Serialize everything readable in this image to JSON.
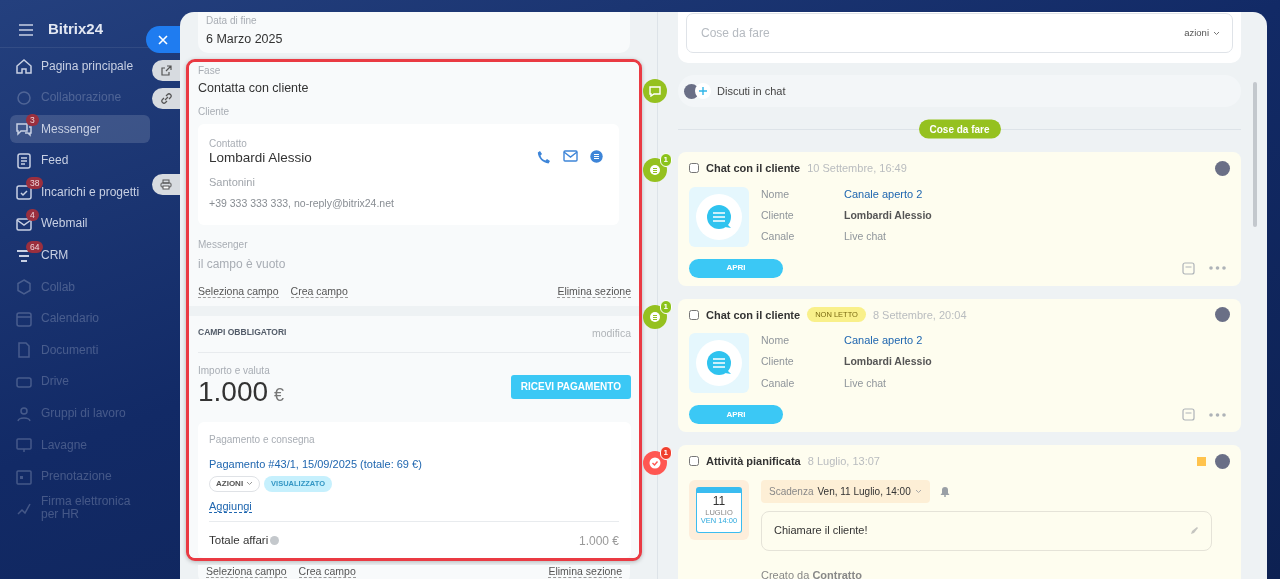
{
  "sidebar": {
    "logo": "Bitrix24",
    "items": [
      {
        "label": "Pagina principale",
        "selected": false,
        "dimmed": false
      },
      {
        "label": "Collaborazione",
        "selected": false,
        "dimmed": true
      },
      {
        "label": "Messenger",
        "badge": "3",
        "selected": true,
        "dimmed": false
      },
      {
        "label": "Feed",
        "selected": false,
        "dimmed": false
      },
      {
        "label": "Incarichi e progetti",
        "badge": "38",
        "selected": false,
        "dimmed": false
      },
      {
        "label": "Webmail",
        "badge": "4",
        "selected": false,
        "dimmed": false
      },
      {
        "label": "CRM",
        "badge": "64",
        "selected": false,
        "dimmed": false
      },
      {
        "label": "Collab",
        "selected": false,
        "dimmed": true
      },
      {
        "label": "Calendario",
        "selected": false,
        "dimmed": true
      },
      {
        "label": "Documenti",
        "selected": false,
        "dimmed": true
      },
      {
        "label": "Drive",
        "selected": false,
        "dimmed": true
      },
      {
        "label": "Gruppi di lavoro",
        "selected": false,
        "dimmed": true
      },
      {
        "label": "Lavagne",
        "selected": false,
        "dimmed": true
      },
      {
        "label": "Prenotazione",
        "selected": false,
        "dimmed": true
      },
      {
        "label": "Firma elettronica per HR",
        "selected": false,
        "dimmed": true
      }
    ]
  },
  "details": {
    "end_date": {
      "label": "Data di fine",
      "value": "6 Marzo 2025"
    },
    "stage": {
      "label": "Fase",
      "value": "Contatta con cliente"
    },
    "client": {
      "label": "Cliente",
      "type_label": "Contatto",
      "name": "Lombardi Alessio",
      "company": "Santonini",
      "contacts": "+39 333 333 333, no-reply@bitrix24.net"
    },
    "messenger": {
      "label": "Messenger",
      "value": "il campo è vuoto"
    },
    "section_links": [
      "Seleziona campo",
      "Crea campo",
      "Elimina sezione"
    ],
    "required": {
      "title": "CAMPI OBBLIGATORI",
      "edit": "modifica",
      "amount_label": "Importo e valuta",
      "amount": "1.000",
      "currency": "€",
      "pay_button": "RICEVI PAGAMENTO",
      "payment": {
        "label": "Pagamento e consegna",
        "link": "Pagamento #43/1, 15/09/2025 (totale: 69 €)",
        "actions": "AZIONI",
        "status": "VISUALIZZATO",
        "add": "Aggiungi",
        "total_label": "Totale affari",
        "total": "1.000 €"
      }
    },
    "section_links_2": [
      "Seleziona campo",
      "Crea campo",
      "Elimina sezione"
    ]
  },
  "timeline": {
    "todo": {
      "placeholder": "Cose da fare",
      "actions": "azioni"
    },
    "discuss": "Discuti in chat",
    "divider": "Cose da fare",
    "activities": [
      {
        "kind": "chat",
        "color": "#95c11f",
        "badge": "1",
        "checked": false,
        "title": "Chat con il cliente",
        "time": "10 Settembre, 16:49",
        "fields": [
          {
            "label": "Nome",
            "value": "Canale aperto 2"
          },
          {
            "label": "Cliente",
            "value": "Lombardi Alessio"
          },
          {
            "label": "Canale",
            "value": "Live chat"
          }
        ],
        "button": "APRI"
      },
      {
        "kind": "chat",
        "color": "#95c11f",
        "badge": "1",
        "checked": false,
        "title": "Chat con il cliente",
        "tag": "NON LETTO",
        "time": "8 Settembre, 20:04",
        "fields": [
          {
            "label": "Nome",
            "value": "Canale aperto 2"
          },
          {
            "label": "Cliente",
            "value": "Lombardi Alessio"
          },
          {
            "label": "Canale",
            "value": "Live chat"
          }
        ],
        "button": "APRI"
      },
      {
        "kind": "task",
        "color": "#ff5752",
        "badge": "1",
        "checked": false,
        "title": "Attività pianificata",
        "time": "8 Luglio, 13:07",
        "flag": true,
        "calendar": {
          "day": "11",
          "month": "LUGLIO",
          "time": "VEN 14:00"
        },
        "deadline_label": "Scadenza",
        "deadline": "Ven, 11 Luglio, 14:00",
        "text": "Chiamare il cliente!",
        "created": "Creato da **Contratto**"
      }
    ]
  }
}
